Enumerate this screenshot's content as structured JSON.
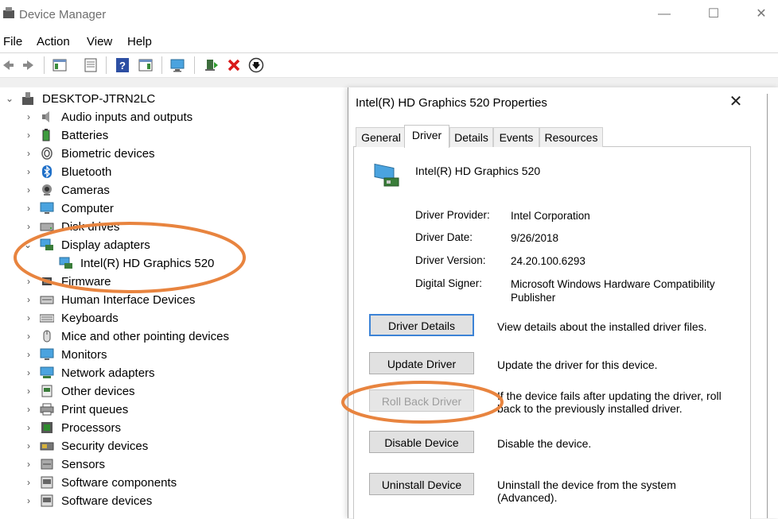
{
  "window": {
    "title": "Device Manager",
    "minimize": "—",
    "maximize": "☐",
    "close": "✕"
  },
  "menu": [
    "File",
    "Action",
    "View",
    "Help"
  ],
  "tree": {
    "root": "DESKTOP-JTRN2LC",
    "items": [
      {
        "label": "Audio inputs and outputs",
        "icon": "speaker-icon"
      },
      {
        "label": "Batteries",
        "icon": "battery-icon"
      },
      {
        "label": "Biometric devices",
        "icon": "fingerprint-icon"
      },
      {
        "label": "Bluetooth",
        "icon": "bluetooth-icon"
      },
      {
        "label": "Cameras",
        "icon": "camera-icon"
      },
      {
        "label": "Computer",
        "icon": "computer-icon"
      },
      {
        "label": "Disk drives",
        "icon": "disk-icon"
      },
      {
        "label": "Display adapters",
        "icon": "display-adapter-icon",
        "expanded": true
      },
      {
        "label": "Intel(R) HD Graphics 520",
        "icon": "display-adapter-icon",
        "child": true
      },
      {
        "label": "Firmware",
        "icon": "chip-icon"
      },
      {
        "label": "Human Interface Devices",
        "icon": "hid-icon"
      },
      {
        "label": "Keyboards",
        "icon": "keyboard-icon"
      },
      {
        "label": "Mice and other pointing devices",
        "icon": "mouse-icon"
      },
      {
        "label": "Monitors",
        "icon": "monitor-icon"
      },
      {
        "label": "Network adapters",
        "icon": "network-icon"
      },
      {
        "label": "Other devices",
        "icon": "unknown-device-icon"
      },
      {
        "label": "Print queues",
        "icon": "printer-icon"
      },
      {
        "label": "Processors",
        "icon": "processor-icon"
      },
      {
        "label": "Security devices",
        "icon": "security-icon"
      },
      {
        "label": "Sensors",
        "icon": "sensor-icon"
      },
      {
        "label": "Software components",
        "icon": "software-icon"
      },
      {
        "label": "Software devices",
        "icon": "software-icon"
      }
    ]
  },
  "dialog": {
    "title": "Intel(R) HD Graphics 520 Properties",
    "close": "✕",
    "tabs": [
      "General",
      "Driver",
      "Details",
      "Events",
      "Resources"
    ],
    "active_tab": "Driver",
    "device_name": "Intel(R) HD Graphics 520",
    "fields": [
      {
        "label": "Driver Provider:",
        "value": "Intel Corporation"
      },
      {
        "label": "Driver Date:",
        "value": "9/26/2018"
      },
      {
        "label": "Driver Version:",
        "value": "24.20.100.6293"
      },
      {
        "label": "Digital Signer:",
        "value": "Microsoft Windows Hardware Compatibility Publisher"
      }
    ],
    "buttons": [
      {
        "label": "Driver Details",
        "desc": "View details about the installed driver files."
      },
      {
        "label": "Update Driver",
        "desc": "Update the driver for this device."
      },
      {
        "label": "Roll Back Driver",
        "desc": "If the device fails after updating the driver, roll back to the previously installed driver."
      },
      {
        "label": "Disable Device",
        "desc": "Disable the device."
      },
      {
        "label": "Uninstall Device",
        "desc": "Uninstall the device from the system (Advanced)."
      }
    ]
  },
  "colors": {
    "annotation": "#e8843f",
    "focus": "#3c83d6",
    "accent": "#1e6fc8"
  }
}
